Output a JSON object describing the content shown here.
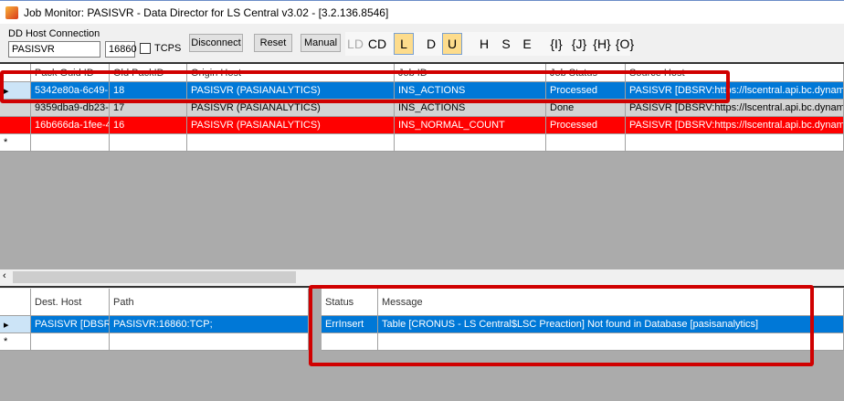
{
  "window": {
    "title": "Job Monitor: PASISVR - Data Director for LS Central v3.02 - [3.2.136.8546]"
  },
  "toolbar": {
    "host_label": "DD Host Connection",
    "host": "PASISVR",
    "port": "16860",
    "tcps": "TCPS",
    "disconnect": "Disconnect",
    "reset": "Reset",
    "manual": "Manual",
    "toggles": [
      {
        "label": "LD",
        "on": false,
        "dim": true
      },
      {
        "label": "CD",
        "on": false
      },
      {
        "label": "L",
        "on": true
      },
      {
        "label": "D",
        "on": false
      },
      {
        "label": "U",
        "on": true
      },
      {
        "label": "H",
        "on": false
      },
      {
        "label": "S",
        "on": false
      },
      {
        "label": "E",
        "on": false
      },
      {
        "label": "{I}",
        "on": false
      },
      {
        "label": "{J}",
        "on": false
      },
      {
        "label": "{H}",
        "on": false
      },
      {
        "label": "{O}",
        "on": false
      }
    ]
  },
  "jobs": {
    "columns": [
      "Pack Guid ID",
      "Old PackID",
      "Origin Host",
      "Job ID",
      "Job Status",
      "Source Host"
    ],
    "rows": [
      [
        "5342e80a-6c49-...",
        "18",
        "PASISVR (PASIANALYTICS)",
        "INS_ACTIONS",
        "Processed",
        "PASISVR [DBSRV:https://lscentral.api.bc.dynamics.com/"
      ],
      [
        "9359dba9-db23-...",
        "17",
        "PASISVR (PASIANALYTICS)",
        "INS_ACTIONS",
        "Done",
        "PASISVR [DBSRV:https://lscentral.api.bc.dynamics.com/"
      ],
      [
        "16b666da-1fee-4...",
        "16",
        "PASISVR (PASIANALYTICS)",
        "INS_NORMAL_COUNT",
        "Processed",
        "PASISVR [DBSRV:https://lscentral.api.bc.dynamics.com/"
      ]
    ],
    "new_row_marker": "*"
  },
  "dest": {
    "columns": [
      "Dest. Host",
      "Path",
      "Status",
      "Message"
    ],
    "rows": [
      [
        "PASISVR [DBSR...",
        "PASISVR:16860:TCP;",
        "ErrInsert",
        "Table [CRONUS - LS Central$LSC Preaction] Not found in Database [pasisanalytics]"
      ]
    ],
    "new_row_marker": "*"
  },
  "colors": {
    "selected": "#0078d7",
    "error_row": "#ff0000",
    "done_row": "#d3d3d3",
    "highlight": "#d00000"
  }
}
